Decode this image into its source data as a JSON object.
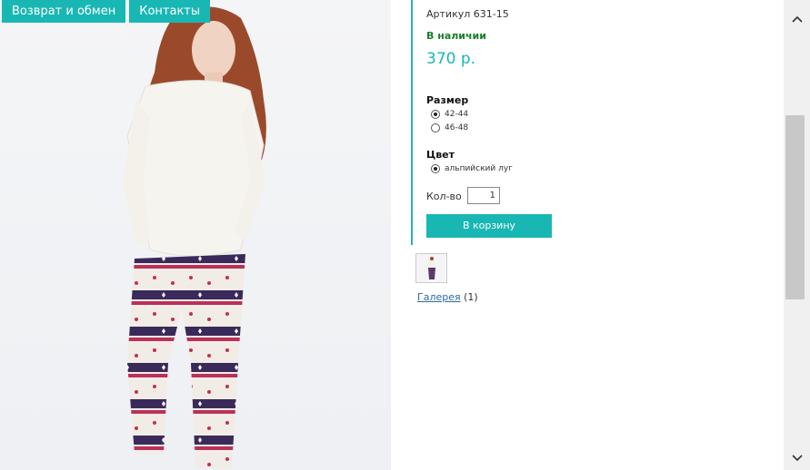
{
  "nav": {
    "items": [
      "Возврат и обмен",
      "Контакты"
    ]
  },
  "product": {
    "sku": "Артикул 631-15",
    "stock": "В наличии",
    "price": "370 р.",
    "size_label": "Размер",
    "sizes": [
      {
        "label": "42-44",
        "selected": true
      },
      {
        "label": "46-48",
        "selected": false
      }
    ],
    "color_label": "Цвет",
    "colors": [
      {
        "label": "альпийский луг",
        "selected": true
      }
    ],
    "qty_label": "Кол-во",
    "qty_value": "1",
    "cart_button": "В корзину"
  },
  "gallery": {
    "link": "Галерея",
    "count": "(1)"
  },
  "colors": {
    "accent": "#19b7b4",
    "stock": "#1a7f2a",
    "link": "#2b6aa8"
  }
}
